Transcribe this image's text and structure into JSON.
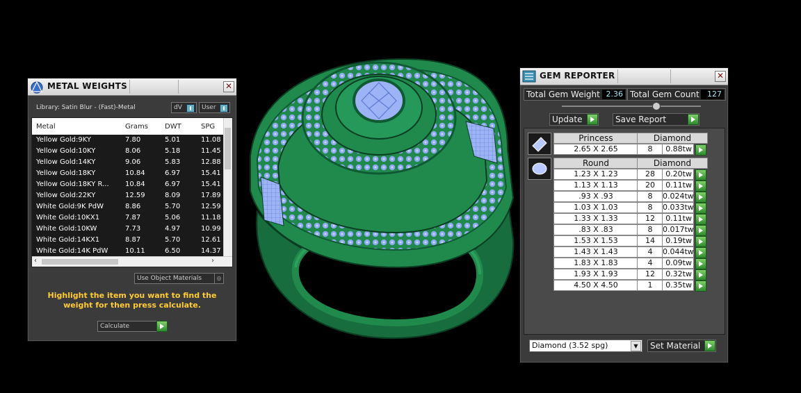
{
  "metal_weights": {
    "title": "METAL WEIGHTS",
    "library_label": "Library: Satin Blur - (Fast)-Metal",
    "unit_button": "dV",
    "user_button": "User",
    "columns": [
      "Metal",
      "Grams",
      "DWT",
      "SPG"
    ],
    "rows": [
      {
        "metal": "Yellow Gold:9KY",
        "grams": "7.80",
        "dwt": "5.01",
        "spg": "11.08"
      },
      {
        "metal": "Yellow Gold:10KY",
        "grams": "8.06",
        "dwt": "5.18",
        "spg": "11.45"
      },
      {
        "metal": "Yellow Gold:14KY",
        "grams": "9.06",
        "dwt": "5.83",
        "spg": "12.88"
      },
      {
        "metal": "Yellow Gold:18KY",
        "grams": "10.84",
        "dwt": "6.97",
        "spg": "15.41"
      },
      {
        "metal": "Yellow Gold:18KY R...",
        "grams": "10.84",
        "dwt": "6.97",
        "spg": "15.41"
      },
      {
        "metal": "Yellow Gold:22KY",
        "grams": "12.59",
        "dwt": "8.09",
        "spg": "17.89"
      },
      {
        "metal": "White Gold:9K PdW",
        "grams": "8.86",
        "dwt": "5.70",
        "spg": "12.59"
      },
      {
        "metal": "White Gold:10KX1",
        "grams": "7.87",
        "dwt": "5.06",
        "spg": "11.18"
      },
      {
        "metal": "White Gold:10KW",
        "grams": "7.73",
        "dwt": "4.97",
        "spg": "10.99"
      },
      {
        "metal": "White Gold:14KX1",
        "grams": "8.87",
        "dwt": "5.70",
        "spg": "12.61"
      },
      {
        "metal": "White Gold:14K PdW",
        "grams": "10.11",
        "dwt": "6.50",
        "spg": "14.37"
      }
    ],
    "use_object_materials": "Use Object Materials",
    "hint": "Highlight the item you want to find the weight for then press calculate.",
    "calculate_button": "Calculate"
  },
  "gem_reporter": {
    "title": "GEM REPORTER",
    "total_weight_label": "Total Gem Weight",
    "total_weight_value": "2.36",
    "total_count_label": "Total Gem Count",
    "total_count_value": "127",
    "update_button": "Update",
    "save_report_button": "Save Report",
    "groups": [
      {
        "shape": "Princess",
        "material": "Diamond",
        "rows": [
          {
            "size": "2.65 X 2.65",
            "count": "8",
            "weight": "0.88tw"
          }
        ]
      },
      {
        "shape": "Round",
        "material": "Diamond",
        "rows": [
          {
            "size": "1.23 X 1.23",
            "count": "28",
            "weight": "0.20tw"
          },
          {
            "size": "1.13 X 1.13",
            "count": "20",
            "weight": "0.11tw"
          },
          {
            "size": ".93 X .93",
            "count": "8",
            "weight": "0.024tw"
          },
          {
            "size": "1.03 X 1.03",
            "count": "8",
            "weight": "0.033tw"
          },
          {
            "size": "1.33 X 1.33",
            "count": "12",
            "weight": "0.11tw"
          },
          {
            "size": ".83 X .83",
            "count": "8",
            "weight": "0.017tw"
          },
          {
            "size": "1.53 X 1.53",
            "count": "14",
            "weight": "0.19tw"
          },
          {
            "size": "1.43 X 1.43",
            "count": "4",
            "weight": "0.044tw"
          },
          {
            "size": "1.83 X 1.83",
            "count": "4",
            "weight": "0.09tw"
          },
          {
            "size": "1.93 X 1.93",
            "count": "12",
            "weight": "0.32tw"
          },
          {
            "size": "4.50 X 4.50",
            "count": "1",
            "weight": "0.35tw"
          }
        ]
      }
    ],
    "material_select": "Diamond      (3.52 spg)",
    "set_material_button": "Set Material"
  },
  "colors": {
    "ring_green": "#1f8a4c",
    "ring_dark": "#0f5a32",
    "gem_blue": "#8aa8f0",
    "hint_yellow": "#ffcc33"
  }
}
